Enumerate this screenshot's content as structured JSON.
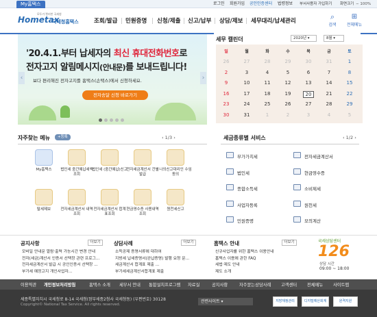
{
  "topbar": {
    "my_tab": "My홈택스",
    "links": [
      "로그인",
      "회원가입",
      "공인인증센터",
      "법령정보",
      "부서사용자 가입하기",
      "화면크기"
    ],
    "zoom": "100%"
  },
  "header": {
    "logo_text": "Hometax",
    "logo_suffix": "국세청홈택스",
    "logo_tag": "모두가 편리한 국세청",
    "nav": [
      "조회/발급",
      "민원증명",
      "신청/제출",
      "신고/납부",
      "상담/제보",
      "세무대리/납세관리"
    ],
    "search_label": "검색",
    "menu_label": "전체메뉴"
  },
  "banner": {
    "line1_prefix": "'20.4.1.부터 납세자의 ",
    "line1_highlight": "최신 휴대전화번호",
    "line1_suffix": "로",
    "line2_prefix": "전자고지 알림메시지",
    "line2_paren": "(안내문)",
    "line2_suffix": "를 보내드립니다!",
    "line3": "보다 편리해진 전자고지를 홈택스(손택스)에서 신청하세요.",
    "button": "전자송달 신청 바로가기",
    "prev": "‹",
    "next": "›"
  },
  "calendar": {
    "title": "세무 캘린더",
    "year": "2020년",
    "month": "8월",
    "weekdays": [
      "일",
      "월",
      "화",
      "수",
      "목",
      "금",
      "토"
    ],
    "weeks": [
      [
        "26",
        "27",
        "28",
        "29",
        "30",
        "31",
        "1"
      ],
      [
        "2",
        "3",
        "4",
        "5",
        "6",
        "7",
        "8"
      ],
      [
        "9",
        "10",
        "11",
        "12",
        "13",
        "14",
        "15"
      ],
      [
        "16",
        "17",
        "18",
        "19",
        "20",
        "21",
        "22"
      ],
      [
        "23",
        "24",
        "25",
        "26",
        "27",
        "28",
        "29"
      ],
      [
        "30",
        "31",
        "1",
        "2",
        "3",
        "4",
        "5"
      ]
    ],
    "today": "20",
    "accent": "#c0392b"
  },
  "freq_menu": {
    "title": "자주찾는 메뉴",
    "register_label": "+등록",
    "pager": "1/3",
    "items": [
      {
        "label": "My홈택스"
      },
      {
        "label": "법인세 중간예납세액 조회"
      },
      {
        "label": "법인세 (중간예납)신고"
      },
      {
        "label": "전자세금계산서 건별발급"
      },
      {
        "label": "나의신고대리인 수임동의"
      },
      {
        "label": "탈세제보"
      },
      {
        "label": "전자세금계산서 내역조회"
      },
      {
        "label": "전자세금계산서 합계표조회"
      },
      {
        "label": "현금영수증 사용내역조회"
      },
      {
        "label": "원천세신고"
      }
    ]
  },
  "tax_service": {
    "title": "세금종류별 서비스",
    "pager": "1/2",
    "items": [
      "부가가치세",
      "전자세금계산서",
      "법인세",
      "현금영수증",
      "종합소득세",
      "소비제세",
      "사업자등록",
      "원천세",
      "민원증명",
      "모의계산"
    ]
  },
  "notices": {
    "title": "공지사항",
    "more": "더보기",
    "items": [
      "모바일 안내문 열람·출력 가능시간 변경 안내",
      "전자(세금)계산서 인증서 선택창 관련 프로그...",
      "전자세금계산서 발급 시 공인인증서 선택창 ...",
      "부가세 예정고지 개인사업자..."
    ]
  },
  "consult": {
    "title": "상담사례",
    "more": "더보기",
    "items": [
      "소득공제 증명서류에 대하여",
      "지방세 납세증명서(완납증명) 발행 요청 문...",
      "세금계산서 합계표 제출 ...",
      "부가세세금계산서합계표 제출"
    ]
  },
  "hometax_info": {
    "title": "홈택스 안내",
    "more": "더보기",
    "items": [
      "신규사업자를 위한 홈택스 이용안내",
      "홈택스 이용에 관한 FAQ",
      "세법·제도 안내",
      "제도 소개"
    ]
  },
  "callcenter": {
    "slogan": "국세상담센터",
    "number": "126",
    "hours_label": "상담 시간",
    "hours": "09:00 ~ 18:00"
  },
  "footer_nav": [
    "이용약관",
    "개인정보처리방침",
    "홈택스 소개",
    "세무서 안내",
    "통합설치프로그램",
    "자료실",
    "공지사항",
    "자주묻는상담사례",
    "고객센터",
    "전체메뉴",
    "사이트맵"
  ],
  "footer": {
    "address": "세종특별자치시 국세청로 8-14 국세청(정부세종2청사 국세청동) (우편번호) 30128",
    "copyright": "Copyright© National Tax Service. All rights reserved.",
    "related_sites": "관련사이트",
    "badge1": "지방재정관리",
    "badge2": "디지털예산회계",
    "badge3": "원격지원"
  }
}
